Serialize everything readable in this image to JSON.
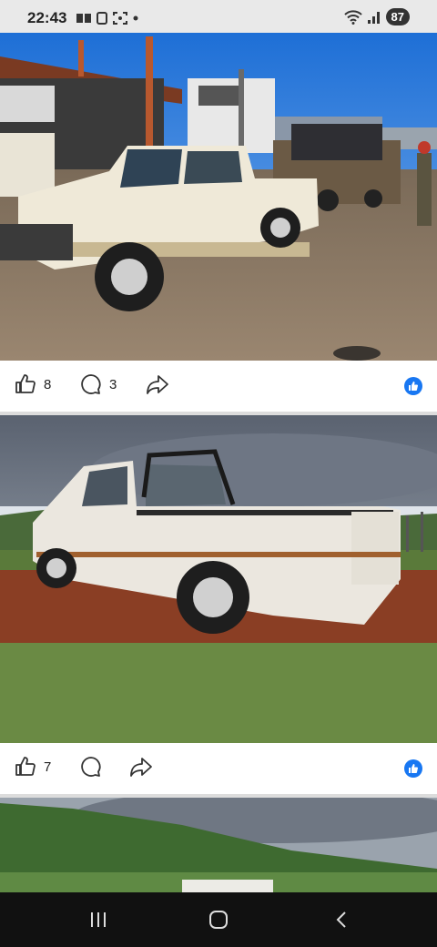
{
  "status_bar": {
    "time": "22:43",
    "battery": "87"
  },
  "posts": [
    {
      "likes": "8",
      "comments": "3"
    },
    {
      "likes": "7",
      "comments": ""
    }
  ],
  "icons": {
    "like": "thumbs-up-icon",
    "comment": "comment-icon",
    "share": "share-icon",
    "reaction": "like-reaction-icon"
  },
  "colors": {
    "accent": "#1877f2",
    "nav_background": "#111111"
  }
}
